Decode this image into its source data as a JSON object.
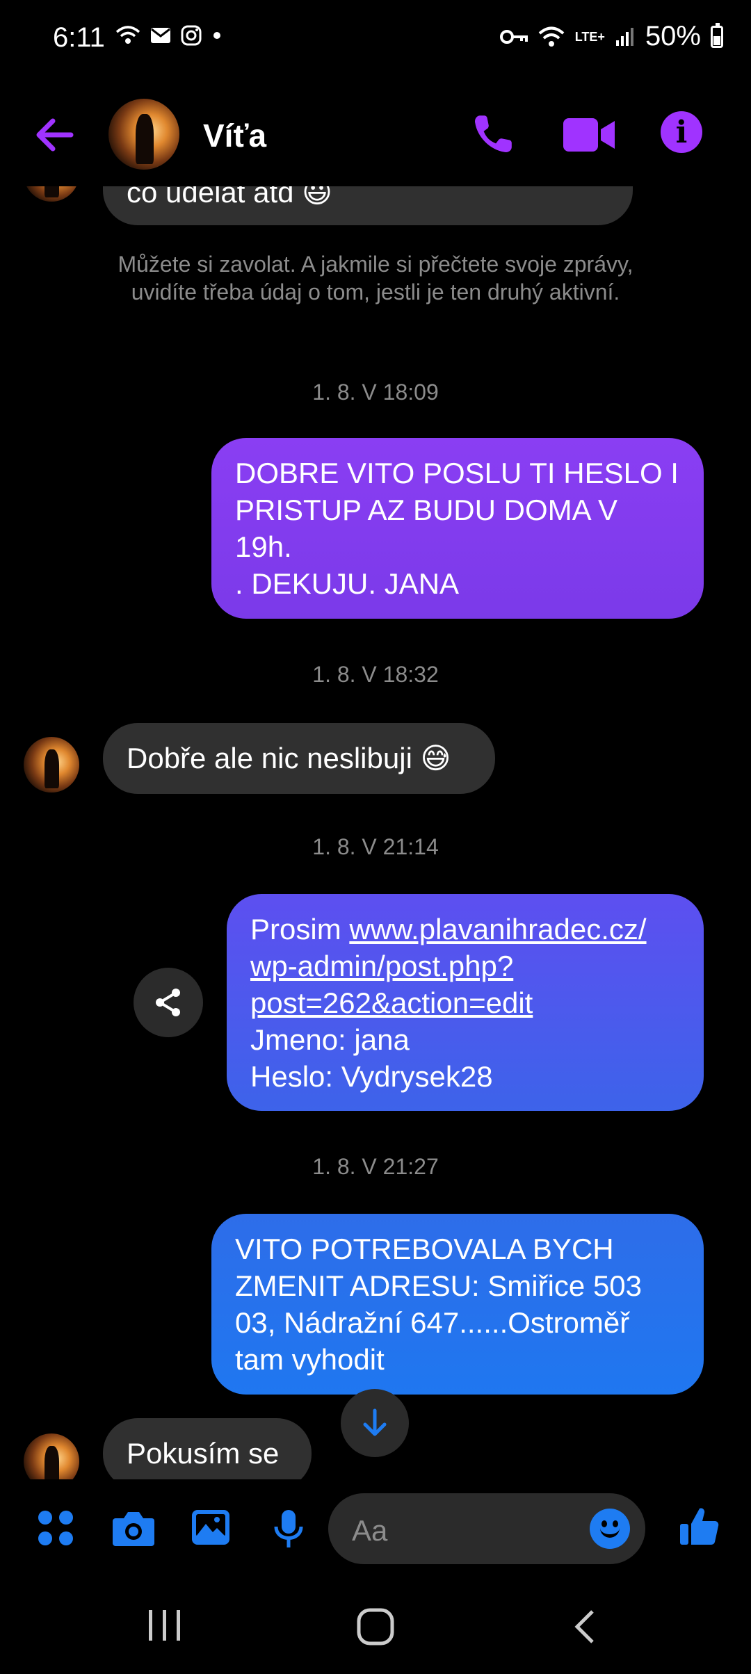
{
  "status_bar": {
    "time": "6:11",
    "network": "LTE+",
    "battery": "50%"
  },
  "header": {
    "contact_name": "Víťa"
  },
  "colors": {
    "accent": "#a033ff",
    "composer_accent": "#1e7cf2",
    "incoming_bubble": "#303030"
  },
  "messages": {
    "partial_top": "co udělat atd 😃",
    "system_notice": "Můžete si zavolat. A jakmile si přečtete svoje zprávy, uvidíte třeba údaj o tom, jestli je ten druhý aktivní.",
    "ts1": "1. 8. V 18:09",
    "out1_line1": "DOBRE VITO  POSLU TI HESLO I",
    "out1_line2": "PRISTUP AZ BUDU DOMA V",
    "out1_line3": "19h.",
    "out1_line4": ". DEKUJU. JANA",
    "ts2": "1. 8. V 18:32",
    "in1": "Dobře ale nic neslibuji 😅",
    "ts3": "1. 8. V 21:14",
    "out2_prefix": "Prosim ",
    "out2_link_line1": "www.plavanihradec.cz/",
    "out2_link_line2": "wp-admin/post.php?",
    "out2_link_line3": "post=262&action=edit",
    "out2_line4": "Jmeno: jana",
    "out2_line5": "Heslo: Vydrysek28",
    "ts4": "1. 8. V 21:27",
    "out3_line1": "VITO POTREBOVALA BYCH",
    "out3_line2": "ZMENIT ADRESU: Smiřice 503",
    "out3_line3": "03, Nádražní 647......Ostroměř",
    "out3_line4": "tam vyhodit",
    "in2": "Pokusím se"
  },
  "composer": {
    "placeholder": "Aa"
  },
  "icons": [
    "back-arrow-icon",
    "phone-icon",
    "video-camera-icon",
    "info-icon",
    "share-icon",
    "arrow-down-icon",
    "apps-grid-icon",
    "camera-icon",
    "gallery-icon",
    "microphone-icon",
    "emoji-icon",
    "thumbs-up-icon",
    "recents-icon",
    "home-icon",
    "nav-back-icon"
  ]
}
